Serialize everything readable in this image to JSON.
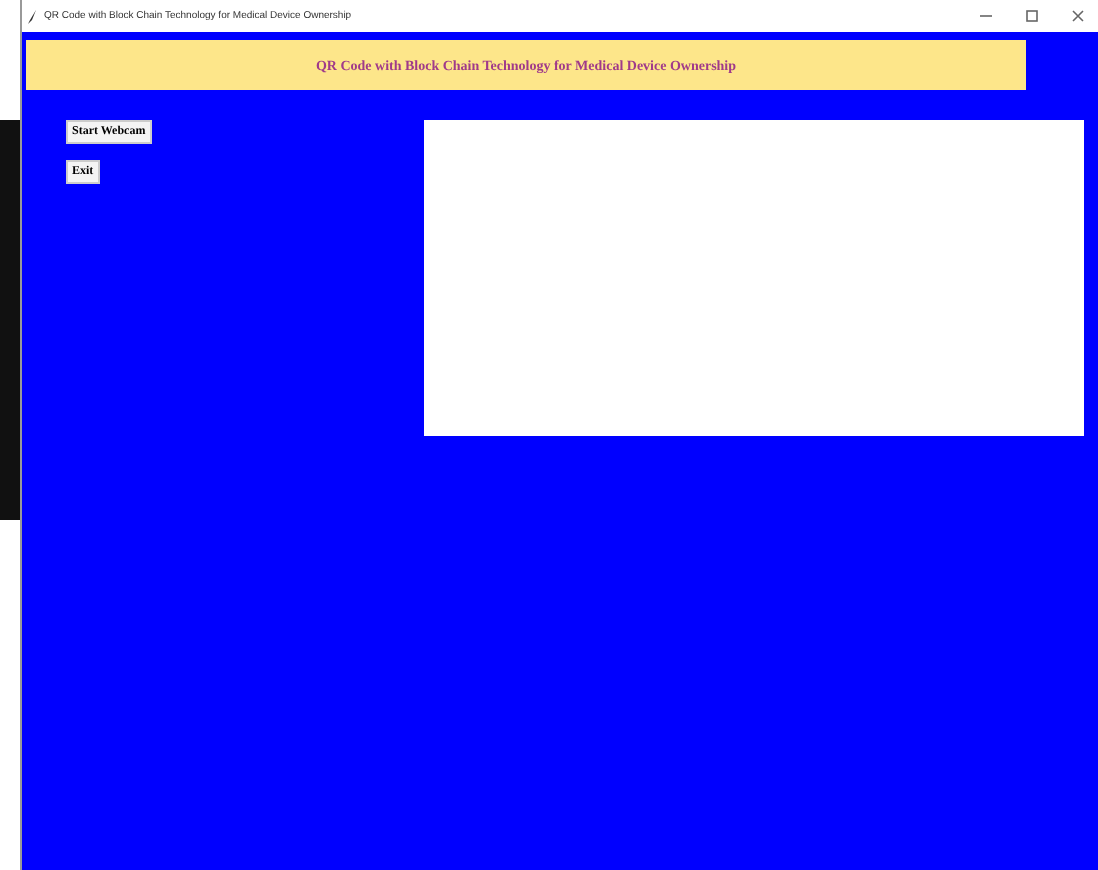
{
  "window": {
    "title": "QR Code with Block Chain Technology for Medical Device Ownership"
  },
  "header": {
    "text": "QR Code with Block Chain Technology for Medical Device Ownership"
  },
  "buttons": [
    "Start Webcam",
    "Exit"
  ]
}
